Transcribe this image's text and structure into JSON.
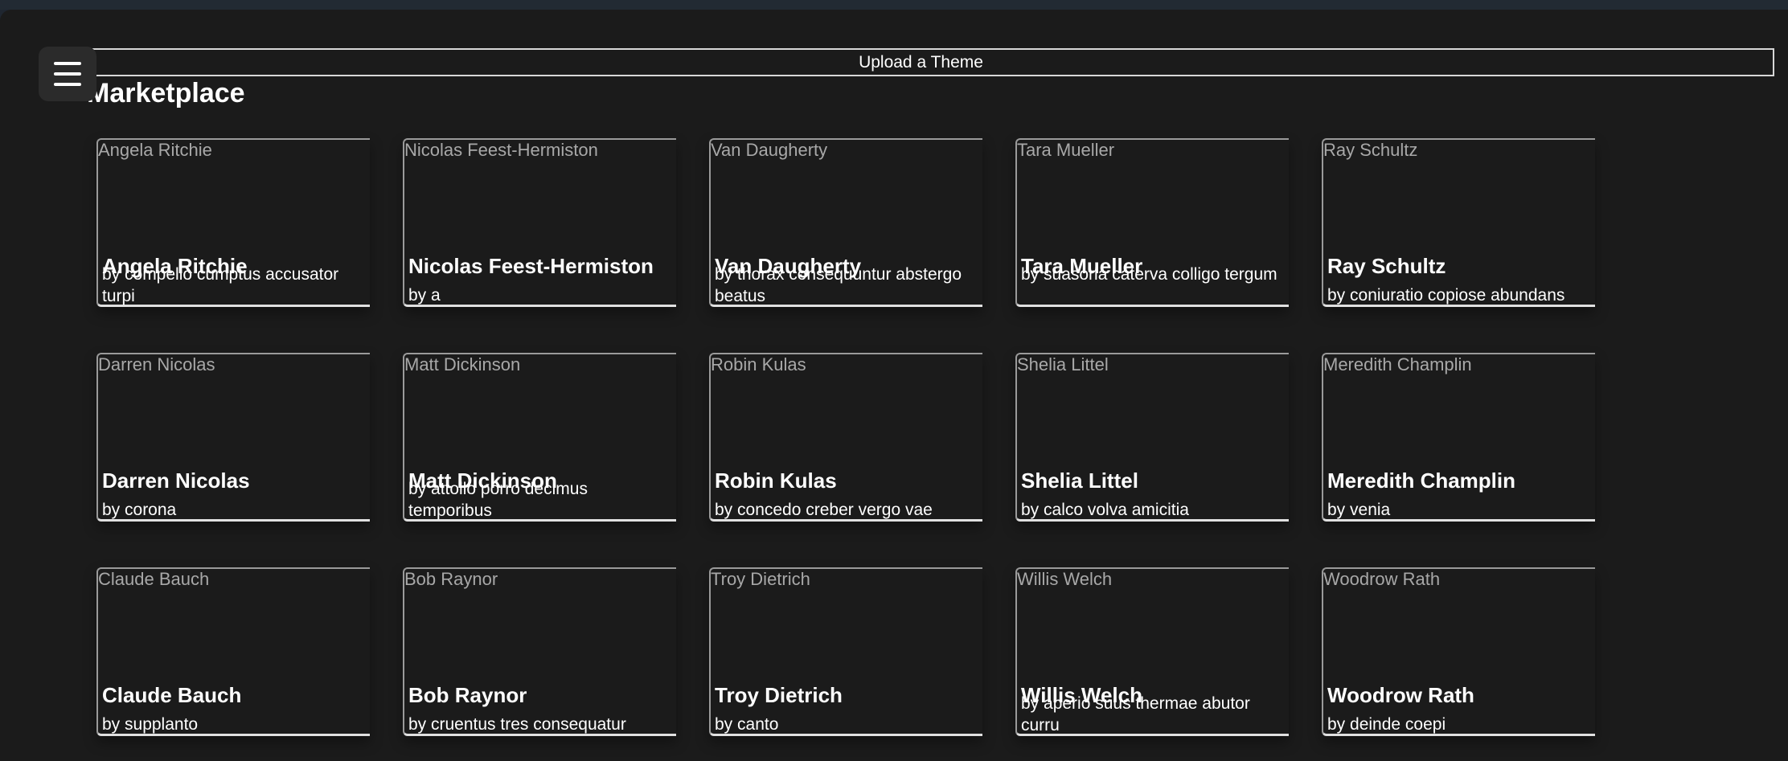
{
  "header": {
    "upload_label": "Upload a Theme"
  },
  "page": {
    "title": "Marketplace"
  },
  "themes": [
    {
      "name": "Angela Ritchie",
      "author": "by compello cumptus accusator turpi"
    },
    {
      "name": "Nicolas Feest-Hermiston",
      "author": "by a"
    },
    {
      "name": "Van Daugherty",
      "author": "by thorax consequuntur abstergo beatus"
    },
    {
      "name": "Tara Mueller",
      "author": "by suasoria caterva colligo tergum"
    },
    {
      "name": "Ray Schultz",
      "author": "by coniuratio copiose abundans"
    },
    {
      "name": "Darren Nicolas",
      "author": "by corona"
    },
    {
      "name": "Matt Dickinson",
      "author": "by attollo porro decimus temporibus"
    },
    {
      "name": "Robin Kulas",
      "author": "by concedo creber vergo vae"
    },
    {
      "name": "Shelia Littel",
      "author": "by calco volva amicitia"
    },
    {
      "name": "Meredith Champlin",
      "author": "by venia"
    },
    {
      "name": "Claude Bauch",
      "author": "by supplanto"
    },
    {
      "name": "Bob Raynor",
      "author": "by cruentus tres consequatur"
    },
    {
      "name": "Troy Dietrich",
      "author": "by canto"
    },
    {
      "name": "Willis Welch",
      "author": "by aperio suus thermae abutor curru"
    },
    {
      "name": "Woodrow Rath",
      "author": "by deinde coepi"
    }
  ],
  "icons": {
    "menu": "hamburger-menu-icon"
  },
  "colors": {
    "background": "#1b1b1b",
    "text": "#ffffff",
    "muted_text": "#a8a8a8"
  }
}
